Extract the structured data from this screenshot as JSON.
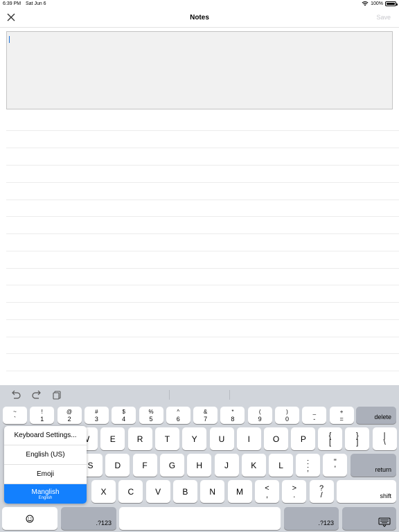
{
  "status_bar": {
    "time": "6:39 PM",
    "date": "Sat Jun 6",
    "battery": "100%"
  },
  "nav": {
    "title": "Notes",
    "save_label": "Save"
  },
  "note": {
    "value": ""
  },
  "keyboard": {
    "toolbar_icons": [
      "undo-icon",
      "redo-icon",
      "paste-icon"
    ],
    "number_row": [
      {
        "top": "~",
        "bot": "`"
      },
      {
        "top": "!",
        "bot": "1"
      },
      {
        "top": "@",
        "bot": "2"
      },
      {
        "top": "#",
        "bot": "3"
      },
      {
        "top": "$",
        "bot": "4"
      },
      {
        "top": "%",
        "bot": "5"
      },
      {
        "top": "^",
        "bot": "6"
      },
      {
        "top": "&",
        "bot": "7"
      },
      {
        "top": "*",
        "bot": "8"
      },
      {
        "top": "(",
        "bot": "9"
      },
      {
        "top": ")",
        "bot": "0"
      },
      {
        "top": "_",
        "bot": "-"
      },
      {
        "top": "+",
        "bot": "="
      }
    ],
    "delete_label": "delete",
    "row_q": [
      "W",
      "E",
      "R",
      "T",
      "Y",
      "U",
      "I",
      "O",
      "P"
    ],
    "row_q_sym": [
      {
        "top": "{",
        "bot": "["
      },
      {
        "top": "}",
        "bot": "]"
      },
      {
        "top": "|",
        "bot": "\\"
      }
    ],
    "row_a": [
      "S",
      "D",
      "F",
      "G",
      "H",
      "J",
      "K",
      "L"
    ],
    "row_a_sym": [
      {
        "top": ":",
        "bot": ";"
      },
      {
        "top": "\"",
        "bot": "'"
      }
    ],
    "return_label": "return",
    "row_z": [
      "X",
      "C",
      "V",
      "B",
      "N",
      "M"
    ],
    "row_z_sym": [
      {
        "top": "<",
        "bot": ","
      },
      {
        "top": ">",
        "bot": "."
      },
      {
        "top": "?",
        "bot": "/"
      }
    ],
    "shift_label": "shift",
    "mode_left_label": ".?123",
    "mode_right_label": ".?123",
    "emoji_icon": "emoji-icon",
    "hide_keyboard_icon": "keyboard-dismiss-icon"
  },
  "input_menu": {
    "items": [
      {
        "label": "Keyboard Settings..."
      },
      {
        "label": "English (US)"
      },
      {
        "label": "Emoji"
      },
      {
        "label": "Manglish",
        "sub": "English",
        "selected": true
      }
    ]
  }
}
